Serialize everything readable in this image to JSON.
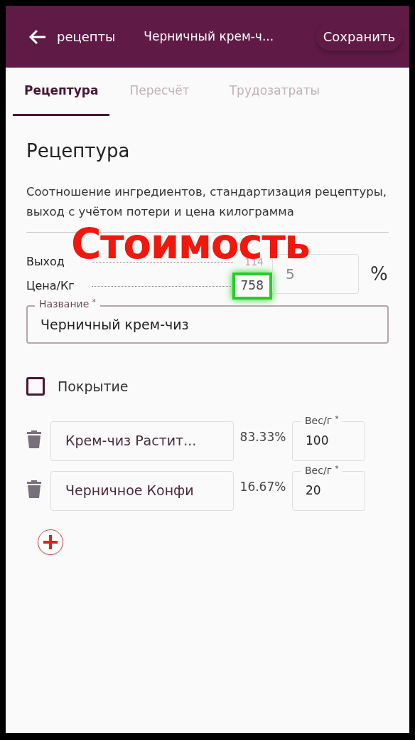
{
  "app_bar": {
    "back": "рецепты",
    "title": "Черничный крем-ч...",
    "save": "Сохранить"
  },
  "tabs": [
    {
      "label": "Рецептура",
      "selected": true
    },
    {
      "label": "Пересчёт",
      "selected": false
    },
    {
      "label": "Трудозатраты",
      "selected": false
    }
  ],
  "heading": "Рецептура",
  "description": "Соотношение ингредиентов, стандартизация рецептуры, выход с учётом потери и цена килограмма",
  "stats": [
    {
      "label": "Выход",
      "value": "114",
      "highlighted": false
    },
    {
      "label": "Цена/Кг",
      "value": "758",
      "highlighted": true
    }
  ],
  "loss_field": {
    "value": "5",
    "unit": "%"
  },
  "name_field": {
    "label": "Название",
    "required": "*",
    "value": "Черничный крем-чиз"
  },
  "coating": {
    "label": "Покрытие",
    "checked": false
  },
  "ingredients": [
    {
      "name": "Крем-чиз Растит...",
      "share": "83.33%",
      "weight_label": "Вес/г",
      "required": "*",
      "weight": "100"
    },
    {
      "name": "Черничное Конфи",
      "share": "16.67%",
      "weight_label": "Вес/г",
      "required": "*",
      "weight": "20"
    }
  ],
  "caption": "Стоимость"
}
